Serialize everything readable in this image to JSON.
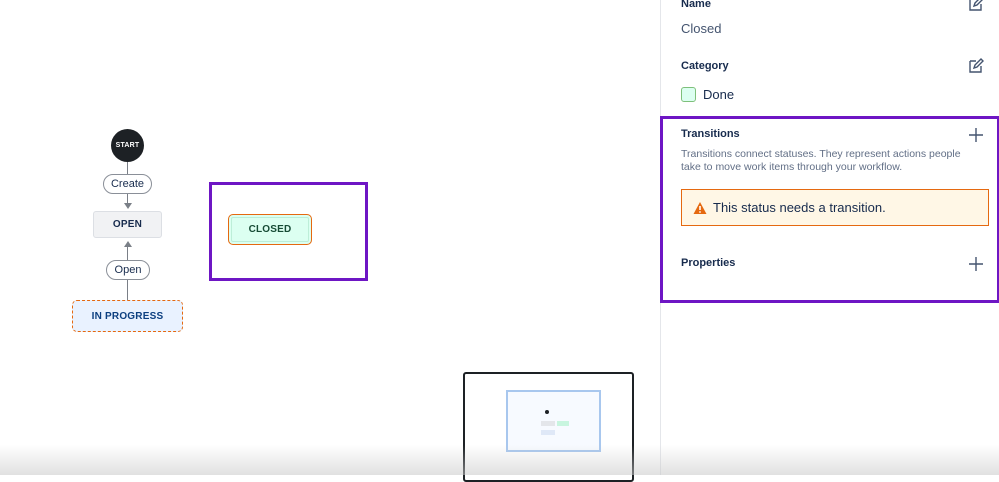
{
  "workflow": {
    "start_label": "START",
    "create_transition": "Create",
    "open_status": "OPEN",
    "open_transition": "Open",
    "in_progress_status": "IN PROGRESS",
    "closed_status": "CLOSED"
  },
  "panel": {
    "name_label": "Name",
    "name_value": "Closed",
    "category_label": "Category",
    "category_value": "Done",
    "transitions_label": "Transitions",
    "transitions_description": "Transitions connect statuses. They represent actions people take to move work items through your workflow.",
    "warning_text": "This status needs a transition.",
    "properties_label": "Properties"
  },
  "colors": {
    "highlight": "#6e16c4",
    "warning_border": "#e56910",
    "done_green": "#dcfff1"
  }
}
